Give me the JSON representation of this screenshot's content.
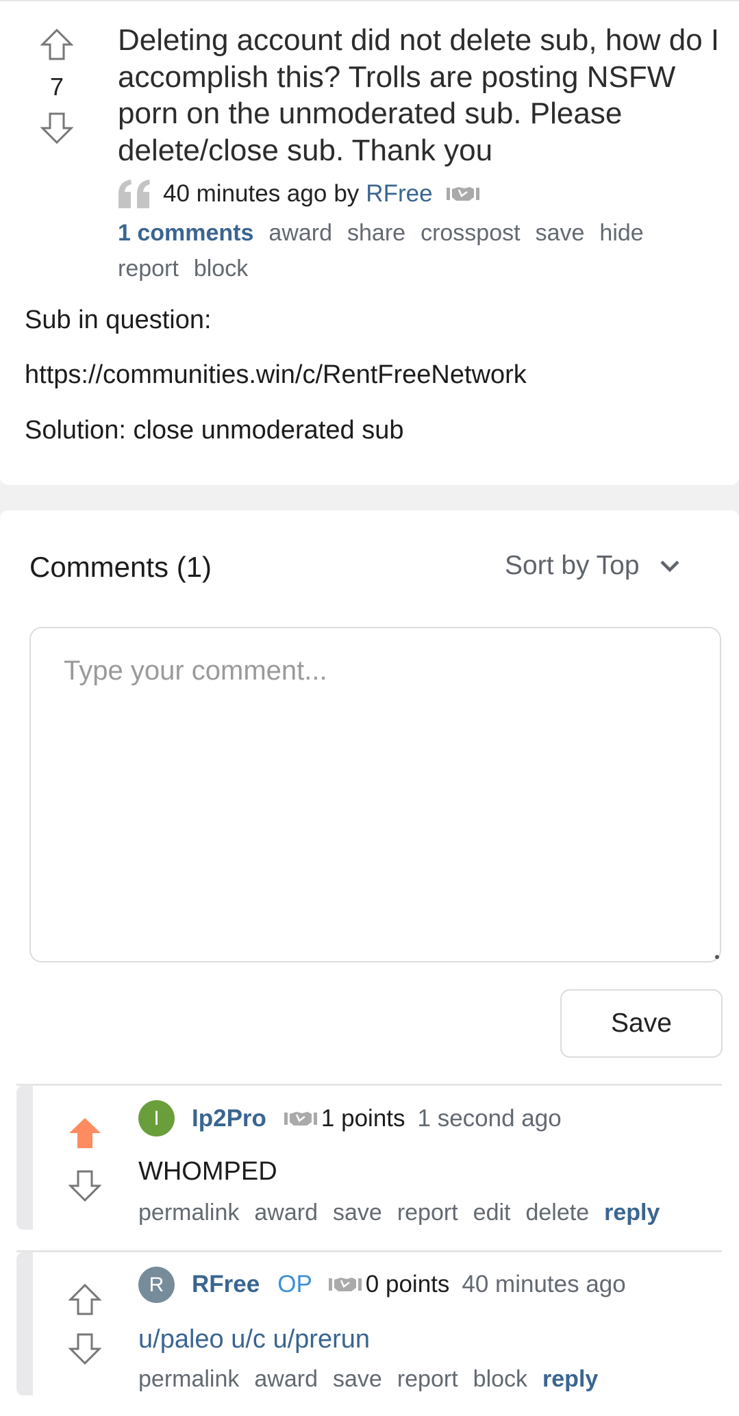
{
  "colors": {
    "link": "#3a6591",
    "op_badge": "#3b8fd6",
    "upvoted": "#ff8b60",
    "avatar_i": "#6a9e3a",
    "avatar_r": "#778c9b",
    "page_bg": "#f1f1f1"
  },
  "post": {
    "score": "7",
    "title": "Deleting account did not delete sub, how do I accomplish this? Trolls are posting NSFW porn on the unmoderated sub. Please delete/close sub. Thank you",
    "time": "40 minutes ago",
    "by": "by",
    "author": "RFree",
    "icons": {
      "upvote": "arrow-up-outline-icon",
      "downvote": "arrow-down-outline-icon",
      "quote": "quote-icon",
      "flair": "handshake-icon"
    },
    "actions": {
      "comments": "1 comments",
      "award": "award",
      "share": "share",
      "crosspost": "crosspost",
      "save": "save",
      "hide": "hide",
      "report": "report",
      "block": "block"
    },
    "body": {
      "line1": "Sub in question:",
      "link": "https://communities.win/c/RentFreeNetwork",
      "line3": "Solution: close unmoderated sub"
    }
  },
  "comments_section": {
    "title": "Comments (1)",
    "sort_label": "Sort by Top",
    "sort_icon": "chevron-down-icon",
    "textarea_placeholder": "Type your comment...",
    "textarea_value": "",
    "save_label": "Save"
  },
  "comments": [
    {
      "avatar_letter": "I",
      "username": "Ip2Pro",
      "op": "",
      "points": "1 points",
      "time": "1 second ago",
      "body": "WHOMPED",
      "upvoted": true,
      "actions": [
        "permalink",
        "award",
        "save",
        "report",
        "edit",
        "delete"
      ],
      "reply": "reply"
    },
    {
      "avatar_letter": "R",
      "username": "RFree",
      "op": "OP",
      "points": "0 points",
      "time": "40 minutes ago",
      "body": "u/paleo u/c u/prerun",
      "upvoted": false,
      "actions": [
        "permalink",
        "award",
        "save",
        "report",
        "block"
      ],
      "reply": "reply"
    }
  ]
}
